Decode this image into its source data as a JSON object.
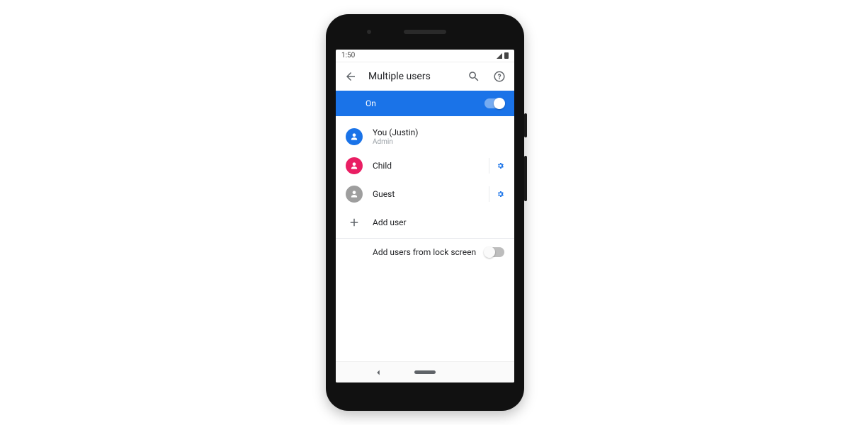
{
  "statusbar": {
    "time": "1:50"
  },
  "appbar": {
    "title": "Multiple users"
  },
  "banner": {
    "label": "On",
    "state": "on"
  },
  "users": [
    {
      "name": "You (Justin)",
      "sub": "Admin",
      "avatar_color": "blue",
      "has_gear": false
    },
    {
      "name": "Child",
      "sub": "",
      "avatar_color": "pink",
      "has_gear": true
    },
    {
      "name": "Guest",
      "sub": "",
      "avatar_color": "grey",
      "has_gear": true
    }
  ],
  "add_user_label": "Add user",
  "lock_setting": {
    "label": "Add users from lock screen",
    "state": "off"
  },
  "colors": {
    "accent": "#1a73e8",
    "pink": "#e91e63",
    "grey": "#9e9e9e"
  }
}
